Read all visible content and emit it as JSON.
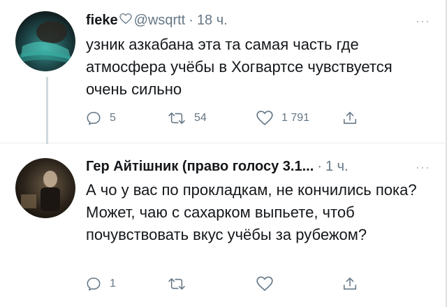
{
  "tweets": [
    {
      "name": "fieke",
      "has_heart": true,
      "handle": "@wsqrtt",
      "separator": "·",
      "time": "18 ч.",
      "text_lines": [
        "узник азкабана эта та самая часть где атмосфера учёбы в Хогвартсе чувствуется очень сильно"
      ],
      "replies": "5",
      "retweets": "54",
      "likes": "1 791",
      "icons": [
        "reply-icon",
        "retweet-icon",
        "like-icon",
        "share-icon"
      ]
    },
    {
      "name": "Гер Айтішник (право голосу 3.1...",
      "separator": "·",
      "time": "1 ч.",
      "text_lines": [
        "А чо у вас по прокладкам, не кончились пока?",
        "Может, чаю с сахарком выпьете, чтоб почувствовать вкус учёбы за рубежом?"
      ],
      "replies": "1",
      "retweets": "",
      "likes": "",
      "icons": [
        "reply-icon",
        "retweet-icon",
        "like-icon",
        "share-icon"
      ]
    }
  ],
  "more_label": "···",
  "colors": {
    "text": "#14171a",
    "secondary": "#657786",
    "divider": "#e6ecf0",
    "thread_line": "#cfd9de"
  }
}
